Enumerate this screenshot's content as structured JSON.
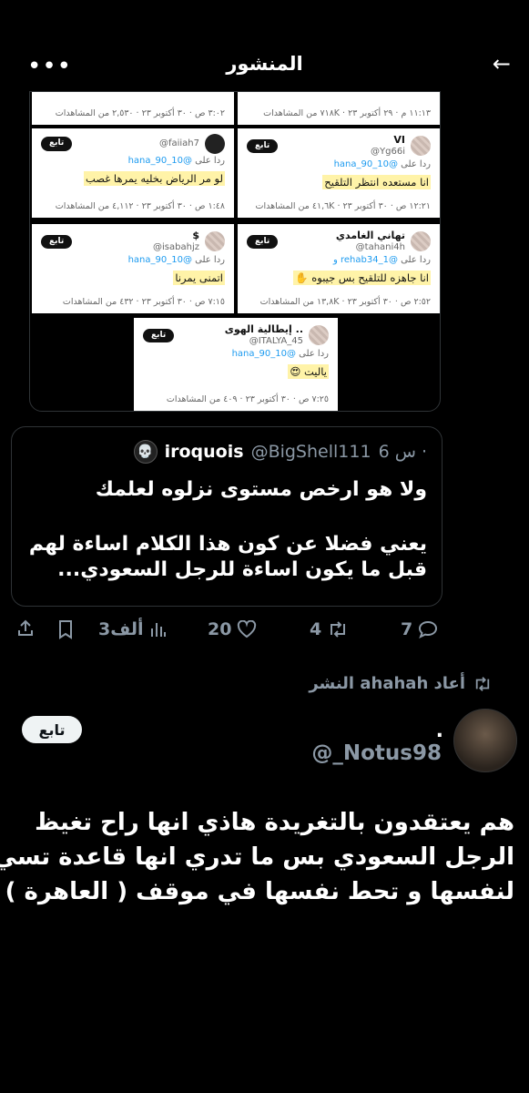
{
  "header": {
    "title": "المنشور",
    "back_icon": "←",
    "more_icon": "•••"
  },
  "cards": {
    "c0": {
      "meta": "٣:٠٢ ص · ٣٠ أكتوبر ٢٣ · ٢,٥٣٠ من المشاهدات"
    },
    "c1": {
      "meta": "١١:١٣ م · ٢٩ أكتوبر ٢٣ · ٧١٨K من المشاهدات"
    },
    "c2": {
      "name": "",
      "handle": "@faiiah7",
      "follow": "تابع",
      "reply_prefix": "ردا على",
      "mention": "@hana_90_10",
      "text": "لو مر الرياض بخليه يمرها غصب",
      "meta": "١:٤٨ ص · ٣٠ أكتوبر ٢٣ · ٤,١١٢ من المشاهدات"
    },
    "c3": {
      "name": "VI",
      "handle": "@Yg66i",
      "follow": "تابع",
      "reply_prefix": "ردا على",
      "mention": "@hana_90_10",
      "text": "انا مستعده انتظر التلقيح",
      "meta": "١٢:٢١ ص · ٣٠ أكتوبر ٢٣ · ٤١,٦K من المشاهدات"
    },
    "c4": {
      "name": "$",
      "handle": "@isabahjz",
      "follow": "تابع",
      "reply_prefix": "ردا على",
      "mention": "@hana_90_10",
      "text": "اتمنى يمرنا",
      "meta": "٧:١٥ ص · ٣٠ أكتوبر ٢٣ · ٤٣٢ من المشاهدات"
    },
    "c5": {
      "name": "تهاني الغامدي",
      "handle": "@tahani4h",
      "follow": "تابع",
      "reply_prefix": "ردا على",
      "mention": "@rehab34_1 و",
      "text": "انا جاهزه للتلقيح بس جيبوه ✋",
      "meta": "٢:٥٢ ص · ٣٠ أكتوبر ٢٣ · ١٣,٨K من المشاهدات"
    },
    "c6": {
      "name": "إيطالية الهوى ..",
      "handle": "@ITALYA_45",
      "follow": "تابع",
      "reply_prefix": "ردا على",
      "mention": "@hana_90_10",
      "text": "ياليت 😍",
      "meta": "٧:٢٥ ص · ٣٠ أكتوبر ٢٣ · ٤٠٩ من المشاهدات"
    }
  },
  "quote": {
    "avatar_icon": "💀",
    "name": "iroquois",
    "handle": "@BigShell111",
    "time": "6 س ·",
    "line1": "ولا هو ارخص مستوى نزلوه لعلمك",
    "line2": "يعني فضلا عن كون هذا الكلام اساءة لهم",
    "line3": "قبل ما يكون اساءة للرجل السعودي..."
  },
  "actions": {
    "replies": "7",
    "reposts": "4",
    "likes": "20",
    "views": "3ألف",
    "reply_icon": "speech-bubble",
    "repost_icon": "repost-arrows",
    "like_icon": "heart",
    "views_icon": "bar-chart",
    "bookmark_icon": "bookmark",
    "share_icon": "share-upload"
  },
  "retweet": {
    "label": "أعاد ahahah النشر"
  },
  "tweet": {
    "name": ".",
    "handle": "@_Notus98",
    "follow": "تابع",
    "line1": "هم يعتقدون بالتغريدة هاذي انها راح تغيظ",
    "line2": "الرجل السعودي بس ما تدري انها قاعدة تسيء",
    "line3": "لنفسها و تحط نفسها في موقف ( العاهرة )"
  }
}
